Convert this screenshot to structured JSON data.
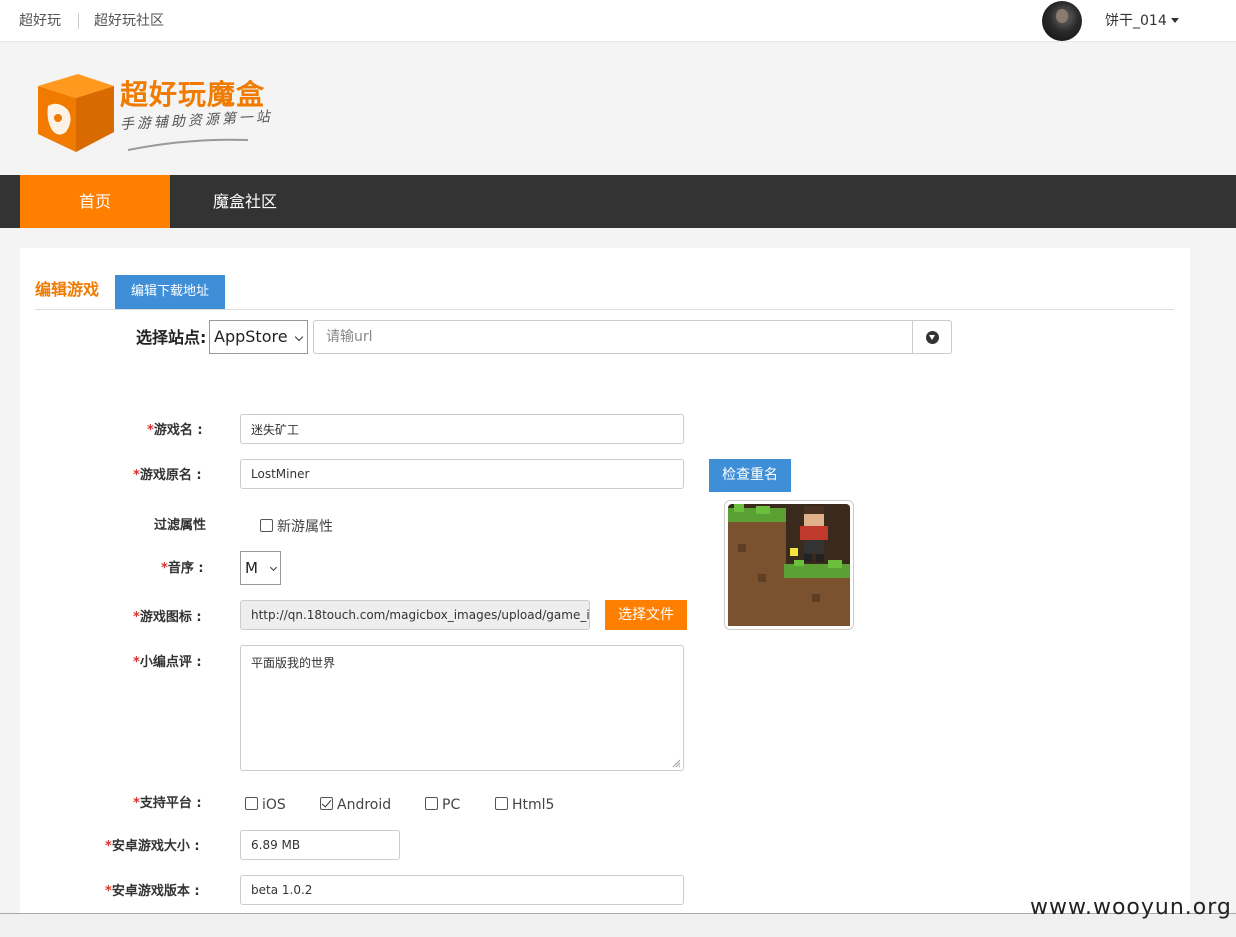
{
  "topbar": {
    "link1": "超好玩",
    "link2": "超好玩社区",
    "username": "饼干_014"
  },
  "logo": {
    "title": "超好玩魔盒",
    "subtitle": "手游辅助资源第一站"
  },
  "nav": {
    "home": "首页",
    "community": "魔盒社区"
  },
  "tabs": {
    "edit_game": "编辑游戏",
    "edit_download": "编辑下载地址"
  },
  "site": {
    "label": "选择站点:",
    "selected": "AppStore",
    "url_placeholder": "请输url"
  },
  "form": {
    "game_name_label": "游戏名 :",
    "game_name_value": "迷失矿工",
    "orig_name_label": "游戏原名 :",
    "orig_name_value": "LostMiner",
    "check_dup_btn": "检查重名",
    "filter_label": "过滤属性",
    "new_attr_label": "新游属性",
    "sort_label": "音序 :",
    "sort_value": "M",
    "icon_label": "游戏图标 :",
    "icon_value": "http://qn.18touch.com/magicbox_images/upload/game_i",
    "choose_file_btn": "选择文件",
    "review_label": "小编点评 :",
    "review_value": "平面版我的世界",
    "platform_label": "支持平台 :",
    "platforms": [
      {
        "label": "iOS",
        "checked": false
      },
      {
        "label": "Android",
        "checked": true
      },
      {
        "label": "PC",
        "checked": false
      },
      {
        "label": "Html5",
        "checked": false
      }
    ],
    "android_size_label": "安卓游戏大小 :",
    "android_size_value": "6.89 MB",
    "android_version_label": "安卓游戏版本 :",
    "android_version_value": "beta 1.0.2",
    "required_mark": "*"
  },
  "watermark": "www.wooyun.org",
  "colors": {
    "accent": "#ff7f00",
    "nav_bg": "#333333",
    "blue": "#3f8fd8"
  }
}
